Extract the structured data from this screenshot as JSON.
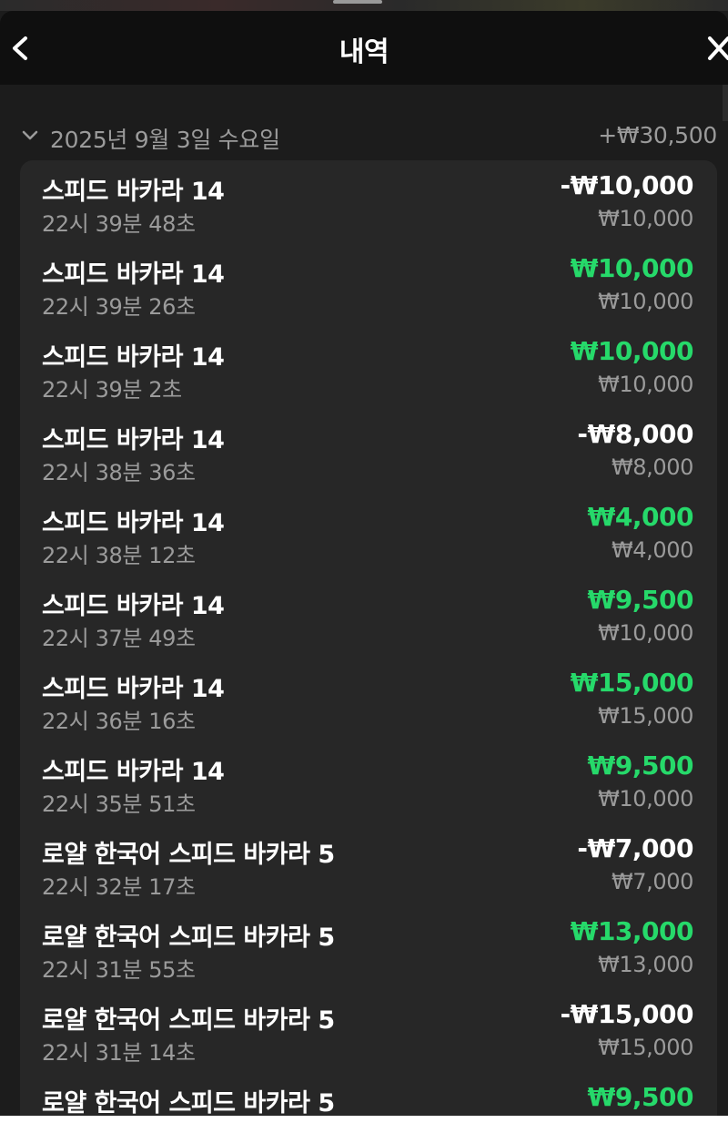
{
  "header": {
    "title": "내역",
    "back_icon": "chevron-left-icon",
    "close_icon": "close-icon"
  },
  "colors": {
    "background": "#1c1c1c",
    "header": "#0f0f0f",
    "card": "#272727",
    "win": "#26d96a",
    "loss": "#ffffff",
    "muted": "#9b9b9b"
  },
  "date_group": {
    "date": "2025년 9월 3일 수요일",
    "total": "+₩30,500",
    "expand_icon": "chevron-down-icon"
  },
  "transactions": [
    {
      "name": "스피드 바카라 14",
      "time": "22시 39분 48초",
      "amount": "-₩10,000",
      "bet": "₩10,000",
      "result": "loss"
    },
    {
      "name": "스피드 바카라 14",
      "time": "22시 39분 26초",
      "amount": "₩10,000",
      "bet": "₩10,000",
      "result": "win"
    },
    {
      "name": "스피드 바카라 14",
      "time": "22시 39분 2초",
      "amount": "₩10,000",
      "bet": "₩10,000",
      "result": "win"
    },
    {
      "name": "스피드 바카라 14",
      "time": "22시 38분 36초",
      "amount": "-₩8,000",
      "bet": "₩8,000",
      "result": "loss"
    },
    {
      "name": "스피드 바카라 14",
      "time": "22시 38분 12초",
      "amount": "₩4,000",
      "bet": "₩4,000",
      "result": "win"
    },
    {
      "name": "스피드 바카라 14",
      "time": "22시 37분 49초",
      "amount": "₩9,500",
      "bet": "₩10,000",
      "result": "win"
    },
    {
      "name": "스피드 바카라 14",
      "time": "22시 36분 16초",
      "amount": "₩15,000",
      "bet": "₩15,000",
      "result": "win"
    },
    {
      "name": "스피드 바카라 14",
      "time": "22시 35분 51초",
      "amount": "₩9,500",
      "bet": "₩10,000",
      "result": "win"
    },
    {
      "name": "로얄 한국어 스피드 바카라 5",
      "time": "22시 32분 17초",
      "amount": "-₩7,000",
      "bet": "₩7,000",
      "result": "loss"
    },
    {
      "name": "로얄 한국어 스피드 바카라 5",
      "time": "22시 31분 55초",
      "amount": "₩13,000",
      "bet": "₩13,000",
      "result": "win"
    },
    {
      "name": "로얄 한국어 스피드 바카라 5",
      "time": "22시 31분 14초",
      "amount": "-₩15,000",
      "bet": "₩15,000",
      "result": "loss"
    },
    {
      "name": "로얄 한국어 스피드 바카라 5",
      "time": "",
      "amount": "₩9,500",
      "bet": "",
      "result": "win"
    }
  ]
}
